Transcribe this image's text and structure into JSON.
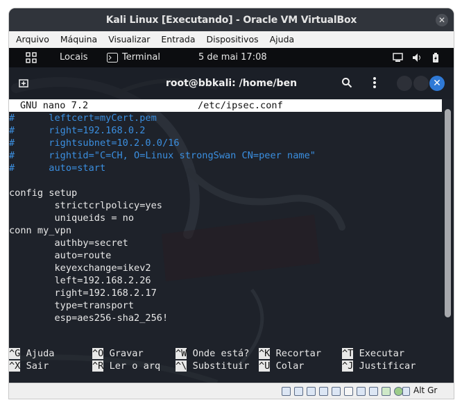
{
  "vbox": {
    "title": "Kali Linux [Executando] - Oracle VM VirtualBox",
    "close_glyph": "✕",
    "menu": [
      "Arquivo",
      "Máquina",
      "Visualizar",
      "Entrada",
      "Dispositivos",
      "Ajuda"
    ],
    "status_text": "Alt Gr"
  },
  "gnome": {
    "places": "Locais",
    "terminal": "Terminal",
    "clock": "5 de mai  17:08"
  },
  "terminal": {
    "title": "root@bbkali: /home/ben",
    "close_glyph": "✕"
  },
  "nano": {
    "version": "GNU nano 7.2",
    "filename": "/etc/ipsec.conf",
    "lines": [
      {
        "text": "#      leftcert=myCert.pem",
        "comment": true
      },
      {
        "text": "#      right=192.168.0.2",
        "comment": true
      },
      {
        "text": "#      rightsubnet=10.2.0.0/16",
        "comment": true
      },
      {
        "text": "#      rightid=\"C=CH, O=Linux strongSwan CN=peer name\"",
        "comment": true
      },
      {
        "text": "#      auto=start",
        "comment": true
      },
      {
        "text": "",
        "comment": false
      },
      {
        "text": "config setup",
        "comment": false
      },
      {
        "text": "        strictcrlpolicy=yes",
        "comment": false
      },
      {
        "text": "        uniqueids = no",
        "comment": false
      },
      {
        "text": "conn my_vpn",
        "comment": false
      },
      {
        "text": "        authby=secret",
        "comment": false
      },
      {
        "text": "        auto=route",
        "comment": false
      },
      {
        "text": "        keyexchange=ikev2",
        "comment": false
      },
      {
        "text": "        left=192.168.2.26",
        "comment": false
      },
      {
        "text": "        right=192.168.2.17",
        "comment": false
      },
      {
        "text": "        type=transport",
        "comment": false
      },
      {
        "text": "        esp=aes256-sha2_256!",
        "comment": false
      }
    ],
    "shortcuts_row1": [
      {
        "key": "^G",
        "label": "Ajuda"
      },
      {
        "key": "^O",
        "label": "Gravar"
      },
      {
        "key": "^W",
        "label": "Onde está?"
      },
      {
        "key": "^K",
        "label": "Recortar"
      },
      {
        "key": "^T",
        "label": "Executar"
      }
    ],
    "shortcuts_row2": [
      {
        "key": "^X",
        "label": "Sair"
      },
      {
        "key": "^R",
        "label": "Ler o arq"
      },
      {
        "key": "^\\",
        "label": "Substituir"
      },
      {
        "key": "^U",
        "label": "Colar"
      },
      {
        "key": "^J",
        "label": "Justificar"
      }
    ]
  },
  "colors": {
    "comment": "#3b8fe0",
    "close_button": "#2f79d6",
    "terminal_bg": "#1e222a"
  }
}
